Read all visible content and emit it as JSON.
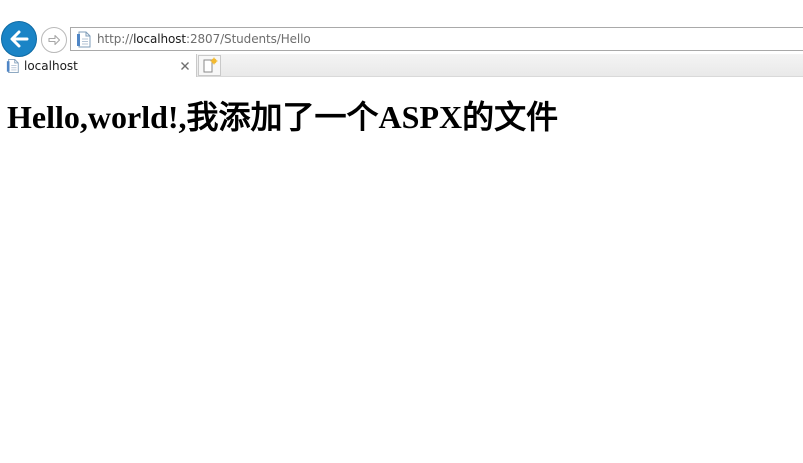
{
  "browser": {
    "address": {
      "url_scheme": "http://",
      "url_host": "localhost",
      "url_rest": ":2807/Students/Hello"
    },
    "tabs": [
      {
        "title": "localhost",
        "active": true
      }
    ],
    "icons": {
      "back": "back-arrow-icon",
      "forward": "forward-arrow-icon",
      "page": "page-icon",
      "close": "close-icon",
      "new_tab": "new-tab-icon"
    },
    "colors": {
      "back_button": "#1a84c6"
    }
  },
  "page": {
    "heading": "Hello,world!,我添加了一个ASPX的文件"
  }
}
